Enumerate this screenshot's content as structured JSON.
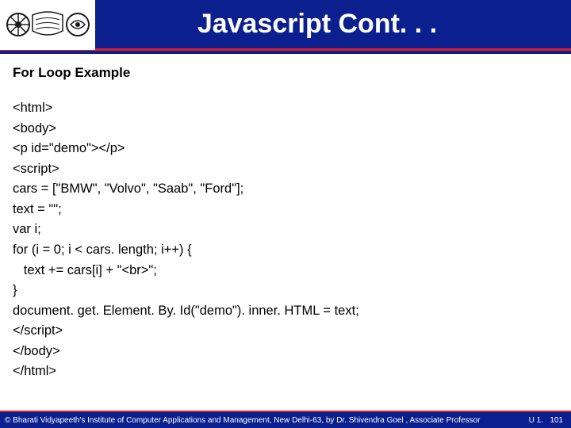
{
  "header": {
    "title": "Javascript Cont. . ."
  },
  "section": {
    "heading": "For Loop Example"
  },
  "code_lines": [
    "<html>",
    "<body>",
    "<p id=\"demo\"></p>",
    "<script>",
    "cars = [\"BMW\", \"Volvo\", \"Saab\", \"Ford\"];",
    "text = \"\";",
    "var i;",
    "for (i = 0; i < cars. length; i++) {",
    "   text += cars[i] + \"<br>\";",
    "}",
    "document. get. Element. By. Id(\"demo\"). inner. HTML = text;",
    "</script>",
    "</body>",
    "</html>"
  ],
  "footer": {
    "copyright": "© Bharati Vidyapeeth's Institute of Computer Applications and Management, New Delhi-63, by  Dr. Shivendra Goel , Associate Professor",
    "unit": "U 1.",
    "page": "101"
  }
}
